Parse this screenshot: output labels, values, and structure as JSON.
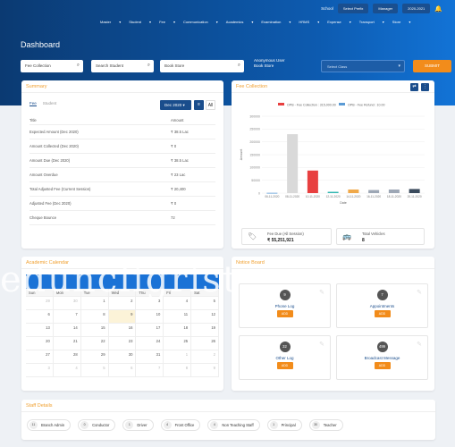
{
  "topbar": {
    "school_label": "School",
    "branch": "Select Prefix",
    "user": "Manager",
    "session": "2020-2021"
  },
  "nav": [
    "Master",
    "Student",
    "Fee",
    "Communication",
    "Academics",
    "Examination",
    "HRMS",
    "Expense",
    "Transport",
    "Store"
  ],
  "page_title": "Dashboard",
  "filters": {
    "fee_collection": "Fee Collection",
    "search_student": "Search Student",
    "book_store": "Book Store",
    "anonymous_line1": "Anonymous User",
    "anonymous_line2": "Book Store",
    "select_class": "Select Class",
    "submit": "SUBMIT"
  },
  "summary": {
    "title": "Summary",
    "tabs": [
      "Fee",
      "Student"
    ],
    "month": "Dec 2020",
    "all": "All",
    "columns": [
      "Title",
      "Amount"
    ],
    "rows": [
      [
        "Expected Amount (Dec 2020)",
        "₹ 38.5 Lac"
      ],
      [
        "Amount Collected (Dec 2020)",
        "₹ 0"
      ],
      [
        "Amount Due (Dec 2020)",
        "₹ 38.5 Lac"
      ],
      [
        "Amount Overdue",
        "₹ 23 Lac"
      ],
      [
        "Total Adjusted Fee (Current Session)",
        "₹ 20,400"
      ],
      [
        "Adjusted Fee (Dec 2020)",
        "₹ 0"
      ],
      [
        "Cheque Bounce",
        "72"
      ]
    ]
  },
  "fee_collection": {
    "title": "Fee Collection",
    "kpis": [
      {
        "label": "Fee Due (All Session)",
        "value": "₹ 55,251,921",
        "icon": "tag-icon"
      },
      {
        "label": "Total Vehicles",
        "value": "8",
        "icon": "bus-icon"
      }
    ]
  },
  "chart_data": {
    "type": "bar",
    "title": "",
    "legend": [
      "OPB - Fee Collection : 315,000.00",
      "OPB - Fee Refund : 10.00"
    ],
    "xlabel": "Date",
    "ylabel": "Amount",
    "ylim": [
      0,
      300000
    ],
    "yticks": [
      0,
      50000,
      100000,
      150000,
      200000,
      250000,
      300000
    ],
    "categories": [
      "06-11-2020",
      "08-11-2020",
      "10-11-2020",
      "12-11-2020",
      "14-11-2020",
      "16-11-2020",
      "18-11-2020",
      "20-11-2020"
    ],
    "values": [
      1000,
      230000,
      88000,
      5000,
      14000,
      12000,
      14000,
      16000
    ],
    "colors": [
      "#5b9bd5",
      "#d9d9d9",
      "#e84040",
      "#2fb6b0",
      "#f0a94a",
      "#9da7b5",
      "#9da7b5",
      "#3a4a5c"
    ]
  },
  "calendar": {
    "title": "Academic Calendar",
    "days": [
      "Sun",
      "Mon",
      "Tue",
      "Wed",
      "Thu",
      "Fri",
      "Sat"
    ],
    "weeks": [
      [
        "29",
        "30",
        "1",
        "2",
        "3",
        "4",
        "5"
      ],
      [
        "6",
        "7",
        "8",
        "9",
        "10",
        "11",
        "12"
      ],
      [
        "13",
        "14",
        "15",
        "16",
        "17",
        "18",
        "19"
      ],
      [
        "20",
        "21",
        "22",
        "23",
        "24",
        "25",
        "26"
      ],
      [
        "27",
        "28",
        "29",
        "30",
        "31",
        "1",
        "2"
      ],
      [
        "3",
        "4",
        "5",
        "6",
        "7",
        "8",
        "9"
      ]
    ]
  },
  "notice": {
    "title": "Notice Board",
    "items": [
      {
        "count": "9",
        "name": "Phone Log",
        "add": "ADD"
      },
      {
        "count": "7",
        "name": "Appointments",
        "add": "ADD"
      },
      {
        "count": "32",
        "name": "Other Log",
        "add": "ADD"
      },
      {
        "count": "499",
        "name": "Broadcast Message",
        "add": "ADD"
      }
    ]
  },
  "staff": {
    "title": "Staff Details",
    "items": [
      {
        "n": "11",
        "label": "Branch Admin"
      },
      {
        "n": "0",
        "label": "Conductor"
      },
      {
        "n": "1",
        "label": "Driver"
      },
      {
        "n": "4",
        "label": "Front Office"
      },
      {
        "n": "4",
        "label": "Non Teaching Staff"
      },
      {
        "n": "1",
        "label": "Principal"
      },
      {
        "n": "30",
        "label": "Teacher"
      }
    ]
  },
  "watermark": "eduncligrist"
}
